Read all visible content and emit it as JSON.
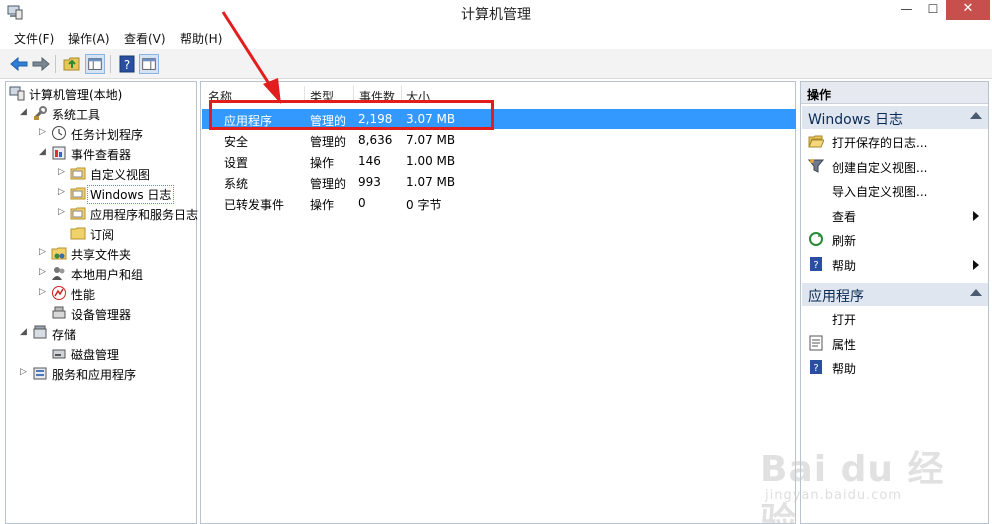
{
  "window": {
    "title": "计算机管理",
    "min_glyph": "—",
    "max_glyph": "☐",
    "close_glyph": "✕"
  },
  "menu": [
    "文件(F)",
    "操作(A)",
    "查看(V)",
    "帮助(H)"
  ],
  "tree": [
    {
      "label": "计算机管理(本地)",
      "level": 0,
      "arrow": "",
      "icon": "computer-management-icon"
    },
    {
      "label": "系统工具",
      "level": 1,
      "arrow": "◢",
      "icon": "system-tools-icon"
    },
    {
      "label": "任务计划程序",
      "level": 2,
      "arrow": "▷",
      "icon": "task-scheduler-icon"
    },
    {
      "label": "事件查看器",
      "level": 2,
      "arrow": "◢",
      "icon": "event-viewer-icon"
    },
    {
      "label": "自定义视图",
      "level": 3,
      "arrow": "▷",
      "icon": "folder-icon"
    },
    {
      "label": "Windows 日志",
      "level": 3,
      "arrow": "▷",
      "icon": "folder-icon",
      "selected": true
    },
    {
      "label": "应用程序和服务日志",
      "level": 3,
      "arrow": "▷",
      "icon": "folder-icon"
    },
    {
      "label": "订阅",
      "level": 3,
      "arrow": "",
      "icon": "subscription-icon"
    },
    {
      "label": "共享文件夹",
      "level": 2,
      "arrow": "▷",
      "icon": "shared-folder-icon"
    },
    {
      "label": "本地用户和组",
      "level": 2,
      "arrow": "▷",
      "icon": "users-icon"
    },
    {
      "label": "性能",
      "level": 2,
      "arrow": "▷",
      "icon": "performance-icon"
    },
    {
      "label": "设备管理器",
      "level": 2,
      "arrow": "",
      "icon": "device-manager-icon"
    },
    {
      "label": "存储",
      "level": 1,
      "arrow": "◢",
      "icon": "storage-icon"
    },
    {
      "label": "磁盘管理",
      "level": 2,
      "arrow": "",
      "icon": "disk-management-icon"
    },
    {
      "label": "服务和应用程序",
      "level": 1,
      "arrow": "▷",
      "icon": "services-icon"
    }
  ],
  "table": {
    "columns": [
      "名称",
      "类型",
      "事件数",
      "大小"
    ],
    "rows": [
      {
        "name": "应用程序",
        "type": "管理的",
        "count": "2,198",
        "size": "3.07 MB",
        "selected": true
      },
      {
        "name": "安全",
        "type": "管理的",
        "count": "8,636",
        "size": "7.07 MB"
      },
      {
        "name": "设置",
        "type": "操作",
        "count": "146",
        "size": "1.00 MB"
      },
      {
        "name": "系统",
        "type": "管理的",
        "count": "993",
        "size": "1.07 MB"
      },
      {
        "name": "已转发事件",
        "type": "操作",
        "count": "0",
        "size": "0 字节"
      }
    ]
  },
  "actions": {
    "header": "操作",
    "sections": [
      {
        "title": "Windows 日志",
        "items": [
          {
            "label": "打开保存的日志...",
            "icon": "open-folder-icon",
            "submenu": false
          },
          {
            "label": "创建自定义视图...",
            "icon": "filter-icon",
            "submenu": false
          },
          {
            "label": "导入自定义视图...",
            "icon": "",
            "submenu": false
          },
          {
            "label": "查看",
            "icon": "",
            "submenu": true
          },
          {
            "label": "刷新",
            "icon": "refresh-icon",
            "submenu": false
          },
          {
            "label": "帮助",
            "icon": "help-icon",
            "submenu": true
          }
        ]
      },
      {
        "title": "应用程序",
        "items": [
          {
            "label": "打开",
            "icon": "",
            "submenu": false
          },
          {
            "label": "属性",
            "icon": "properties-icon",
            "submenu": false
          },
          {
            "label": "帮助",
            "icon": "help-icon",
            "submenu": false
          }
        ]
      }
    ]
  },
  "watermark": {
    "big": "Bai du 经验",
    "small": "jingyan.baidu.com"
  },
  "colors": {
    "selection": "#3399ff",
    "annotation": "#e21d1d",
    "close_button": "#c7504d"
  }
}
